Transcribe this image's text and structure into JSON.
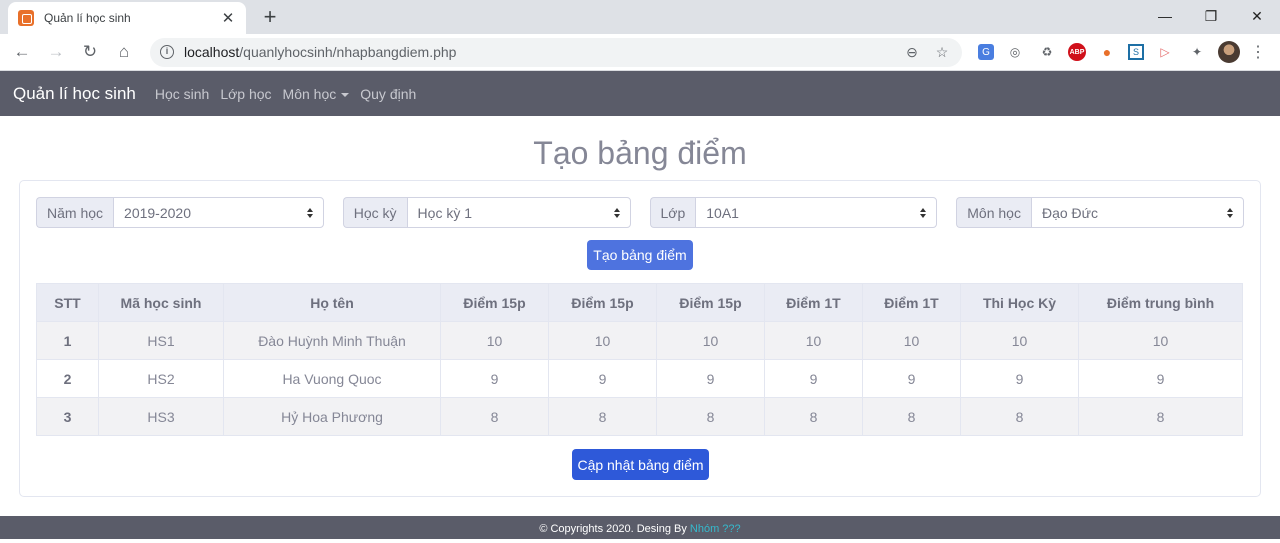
{
  "browser": {
    "tab_title": "Quản lí học sinh",
    "url_host": "localhost",
    "url_path": "/quanlyhocsinh/nhapbangdiem.php"
  },
  "navbar": {
    "brand": "Quản lí học sinh",
    "links": [
      "Học sinh",
      "Lớp học",
      "Môn học",
      "Quy định"
    ]
  },
  "page_title": "Tạo bảng điểm",
  "filters": [
    {
      "label": "Năm học",
      "value": "2019-2020"
    },
    {
      "label": "Học kỳ",
      "value": "Học kỳ 1"
    },
    {
      "label": "Lớp",
      "value": "10A1"
    },
    {
      "label": "Môn học",
      "value": "Đạo Đức"
    }
  ],
  "create_button": "Tạo bảng điểm",
  "update_button": "Cập nhật bảng điểm",
  "table": {
    "headers": [
      "STT",
      "Mã học sinh",
      "Họ tên",
      "Điểm 15p",
      "Điểm 15p",
      "Điểm 15p",
      "Điểm 1T",
      "Điểm 1T",
      "Thi Học Kỳ",
      "Điểm trung bình"
    ],
    "rows": [
      [
        "1",
        "HS1",
        "Đào Huỳnh Minh Thuận",
        "10",
        "10",
        "10",
        "10",
        "10",
        "10",
        "10"
      ],
      [
        "2",
        "HS2",
        "Ha Vuong Quoc",
        "9",
        "9",
        "9",
        "9",
        "9",
        "9",
        "9"
      ],
      [
        "3",
        "HS3",
        "Hỷ Hoa Phương",
        "8",
        "8",
        "8",
        "8",
        "8",
        "8",
        "8"
      ]
    ]
  },
  "footer": {
    "text": "© Copyrights 2020. Desing By ",
    "team": "Nhóm ???"
  }
}
